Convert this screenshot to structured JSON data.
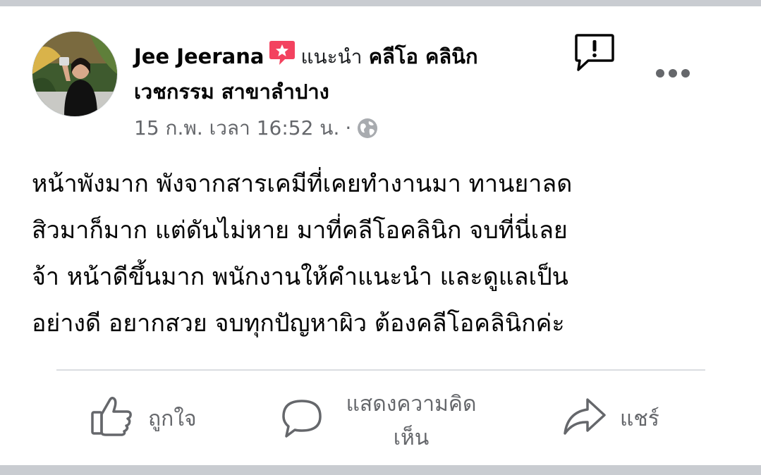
{
  "post": {
    "author": "Jee Jeerana",
    "recommend_text": "แนะนำ",
    "page_name_line1": "คลีโอ คลินิก",
    "page_name_line2": "เวชกรรม สาขาลำปาง",
    "timestamp": "15 ก.พ. เวลา 16:52 น.",
    "separator": "·",
    "privacy_icon": "globe-icon",
    "text_lines": [
      "หน้าพังมาก พังจากสารเคมีที่เคยทำงานมา ทานยาลด",
      "สิวมาก็มาก แต่ดันไม่หาย มาที่คลีโอคลินิก จบที่นี่เลย",
      "จ้า หน้าดีขึ้นมาก พนักงานให้คำแนะนำ และดูแลเป็น",
      "อย่างดี อยากสวย จบทุกปัญหาผิว ต้องคลีโอคลินิกค่ะ"
    ]
  },
  "actions": {
    "like": "ถูกใจ",
    "comment_line1": "แสดงความคิด",
    "comment_line2": "เห็น",
    "share": "แชร์"
  },
  "icons": [
    "recommend-badge-icon",
    "report-icon",
    "more-options-icon",
    "globe-icon",
    "like-icon",
    "comment-icon",
    "share-icon"
  ],
  "colors": {
    "recommend_badge": "#f3425f",
    "secondary_text": "#65676b",
    "divider": "#dadde1",
    "frame_bar": "#c9ccd1"
  }
}
